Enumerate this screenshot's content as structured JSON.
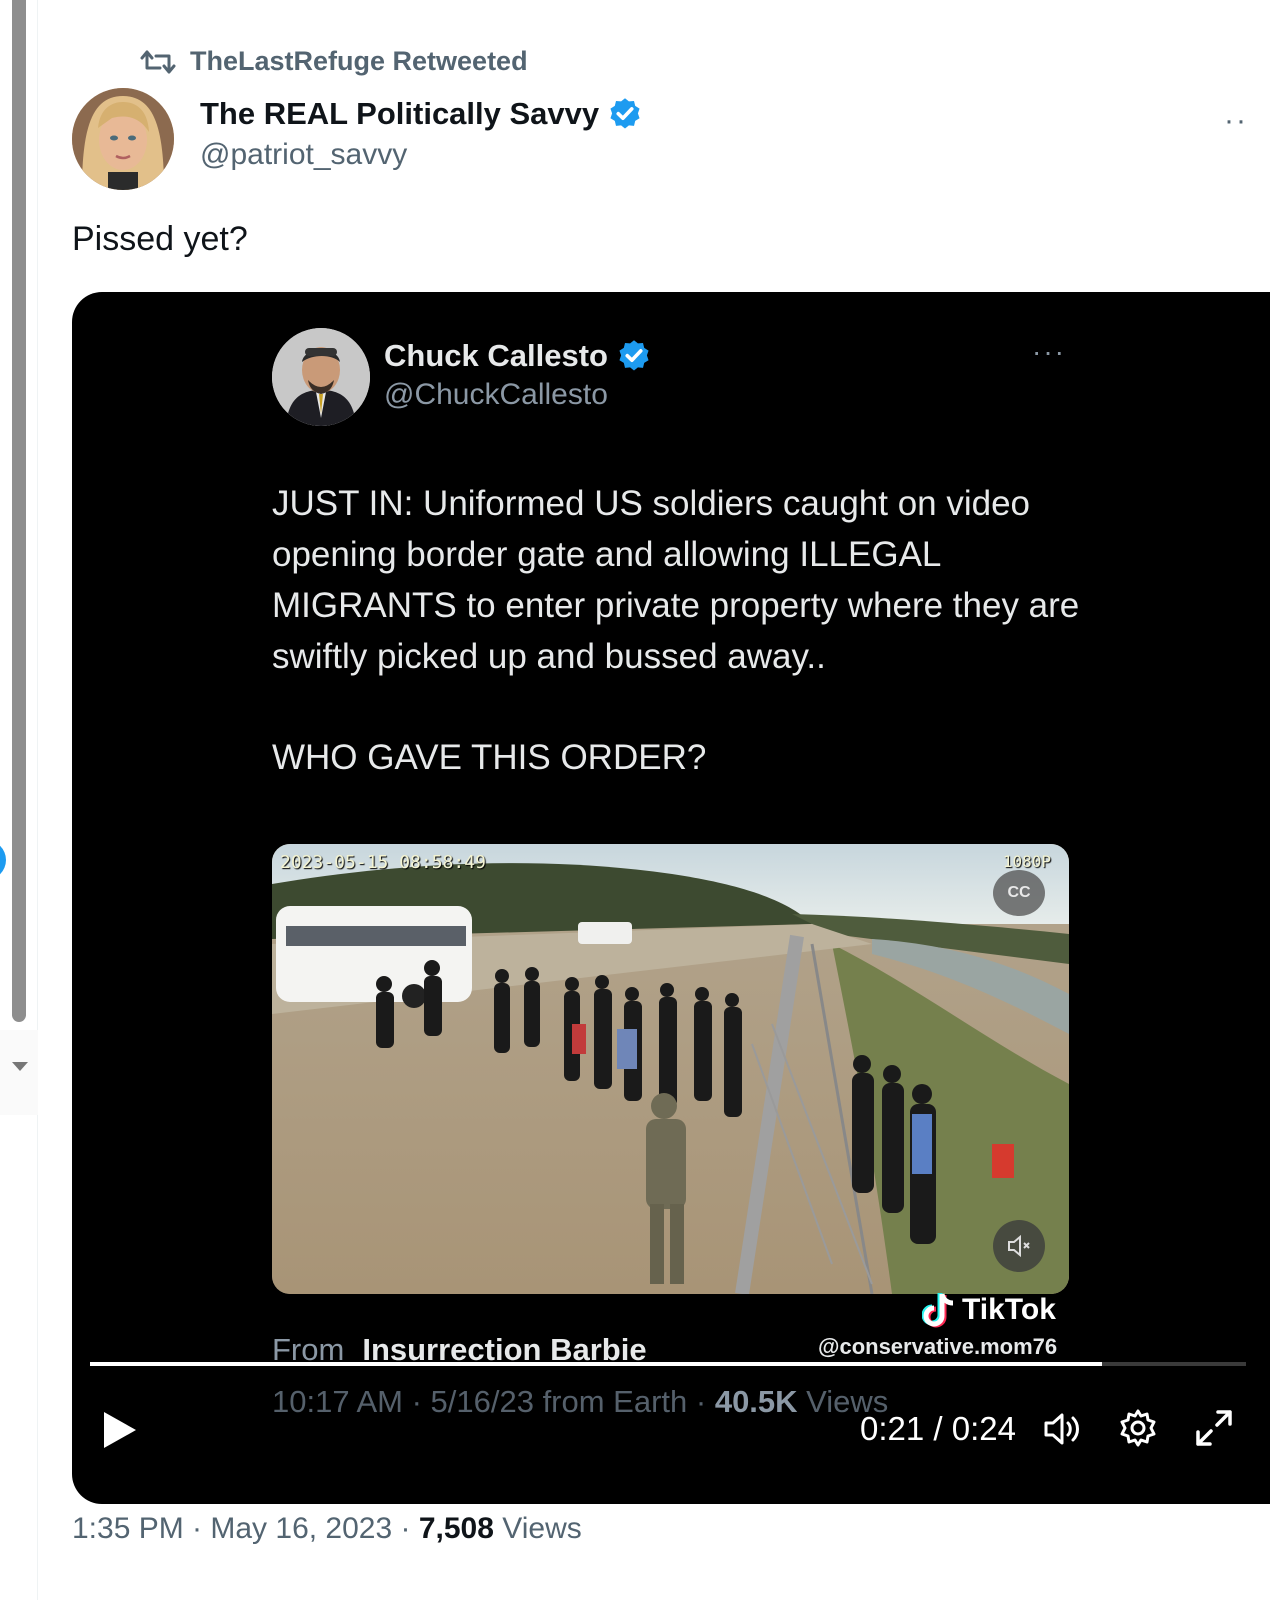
{
  "retweet": {
    "label": "TheLastRefuge Retweeted"
  },
  "author": {
    "name": "The REAL Politically Savvy",
    "handle": "@patriot_savvy"
  },
  "tweet": {
    "text": "Pissed yet?"
  },
  "embedded": {
    "name": "Chuck Callesto",
    "handle": "@ChuckCallesto",
    "body_1": "JUST IN: Uniformed US soldiers caught on video opening border gate and allowing ILLEGAL MIGRANTS to enter private property where they are swiftly picked up and bussed away..",
    "body_2": "WHO GAVE THIS ORDER?",
    "video_timestamp": "2023-05-15 08:58:49",
    "video_resolution": "1080P",
    "from_label": "From",
    "from_name": "Insurrection Barbie",
    "tiktok_brand": "TikTok",
    "tiktok_user": "@conservative.mom76",
    "meta_time": "10:17 AM · 5/16/23 from Earth · ",
    "meta_views_count": "40.5K",
    "meta_views_label": " Views"
  },
  "player": {
    "current": "0:21",
    "duration": "0:24",
    "time_display": "0:21 / 0:24",
    "progress": 0.875
  },
  "footer": {
    "datetime": "1:35 PM · May 16, 2023 · ",
    "views_count": "7,508",
    "views_label": " Views"
  },
  "colors": {
    "accent": "#1d9bf0",
    "text": "#0f1419",
    "muted": "#536471",
    "media_bg": "#000000"
  },
  "icons": [
    "retweet-icon",
    "verified-badge-icon",
    "more-icon",
    "play-icon",
    "volume-icon",
    "gear-icon",
    "fullscreen-icon",
    "mute-icon",
    "captions-icon",
    "tiktok-icon"
  ]
}
